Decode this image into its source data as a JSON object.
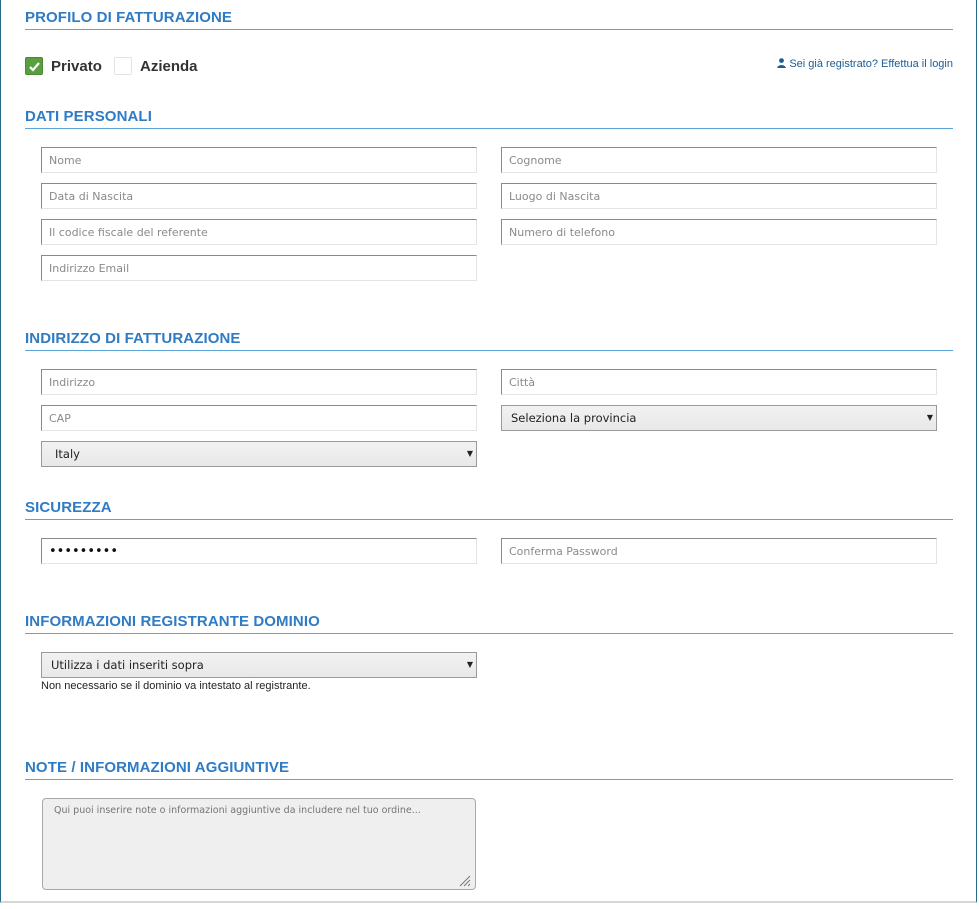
{
  "sections": {
    "billing_profile": "PROFILO DI FATTURAZIONE",
    "personal_data": "DATI PERSONALI",
    "billing_address": "INDIRIZZO DI FATTURAZIONE",
    "security": "SICUREZZA",
    "registrant_info": "INFORMAZIONI REGISTRANTE DOMINIO",
    "notes": "NOTE / INFORMAZIONI AGGIUNTIVE"
  },
  "profile": {
    "private_label": "Privato",
    "private_checked": true,
    "company_label": "Azienda",
    "company_checked": false,
    "login_link": "Sei già registrato? Effettua il login",
    "login_icon": "user-icon"
  },
  "personal": {
    "name_placeholder": "Nome",
    "surname_placeholder": "Cognome",
    "birthdate_placeholder": "Data di Nascita",
    "birthplace_placeholder": "Luogo di Nascita",
    "fiscal_code_placeholder": "Il codice fiscale del referente",
    "phone_placeholder": "Numero di telefono",
    "email_placeholder": "Indirizzo Email"
  },
  "address": {
    "street_placeholder": "Indirizzo",
    "city_placeholder": "Città",
    "zip_placeholder": "CAP",
    "province_selected": "Seleziona la provincia",
    "country_selected": "Italy"
  },
  "security": {
    "password_value": "password1",
    "confirm_placeholder": "Conferma Password"
  },
  "registrant": {
    "selected": "Utilizza i dati inseriti sopra",
    "hint": "Non necessario se il dominio va intestato al registrante."
  },
  "notes": {
    "placeholder": "Qui puoi inserire note o informazioni aggiuntive da includere nel tuo ordine..."
  },
  "colors": {
    "accent": "#2f7bc4",
    "check_green": "#5a9f3e"
  }
}
